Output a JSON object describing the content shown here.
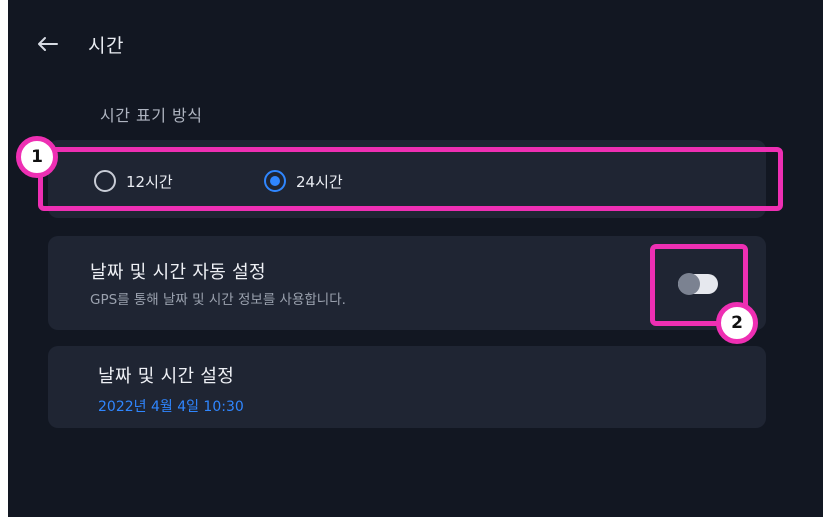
{
  "header": {
    "title": "시간",
    "back_icon": "arrow-left-icon"
  },
  "time_format": {
    "section_label": "시간 표기 방식",
    "options": [
      {
        "label": "12시간",
        "selected": false
      },
      {
        "label": "24시간",
        "selected": true
      }
    ]
  },
  "auto_setting": {
    "title": "날짜 및 시간 자동 설정",
    "description": "GPS를 통해 날짜 및 시간 정보를 사용합니다.",
    "toggle_on": false
  },
  "manual_setting": {
    "title": "날짜 및 시간 설정",
    "value": "2022년 4월 4일 10:30"
  },
  "annotations": {
    "badge_1": "1",
    "badge_2": "2"
  },
  "colors": {
    "background": "#121722",
    "card": "#1f2533",
    "accent": "#2f86ff",
    "highlight": "#ee2fb3"
  }
}
